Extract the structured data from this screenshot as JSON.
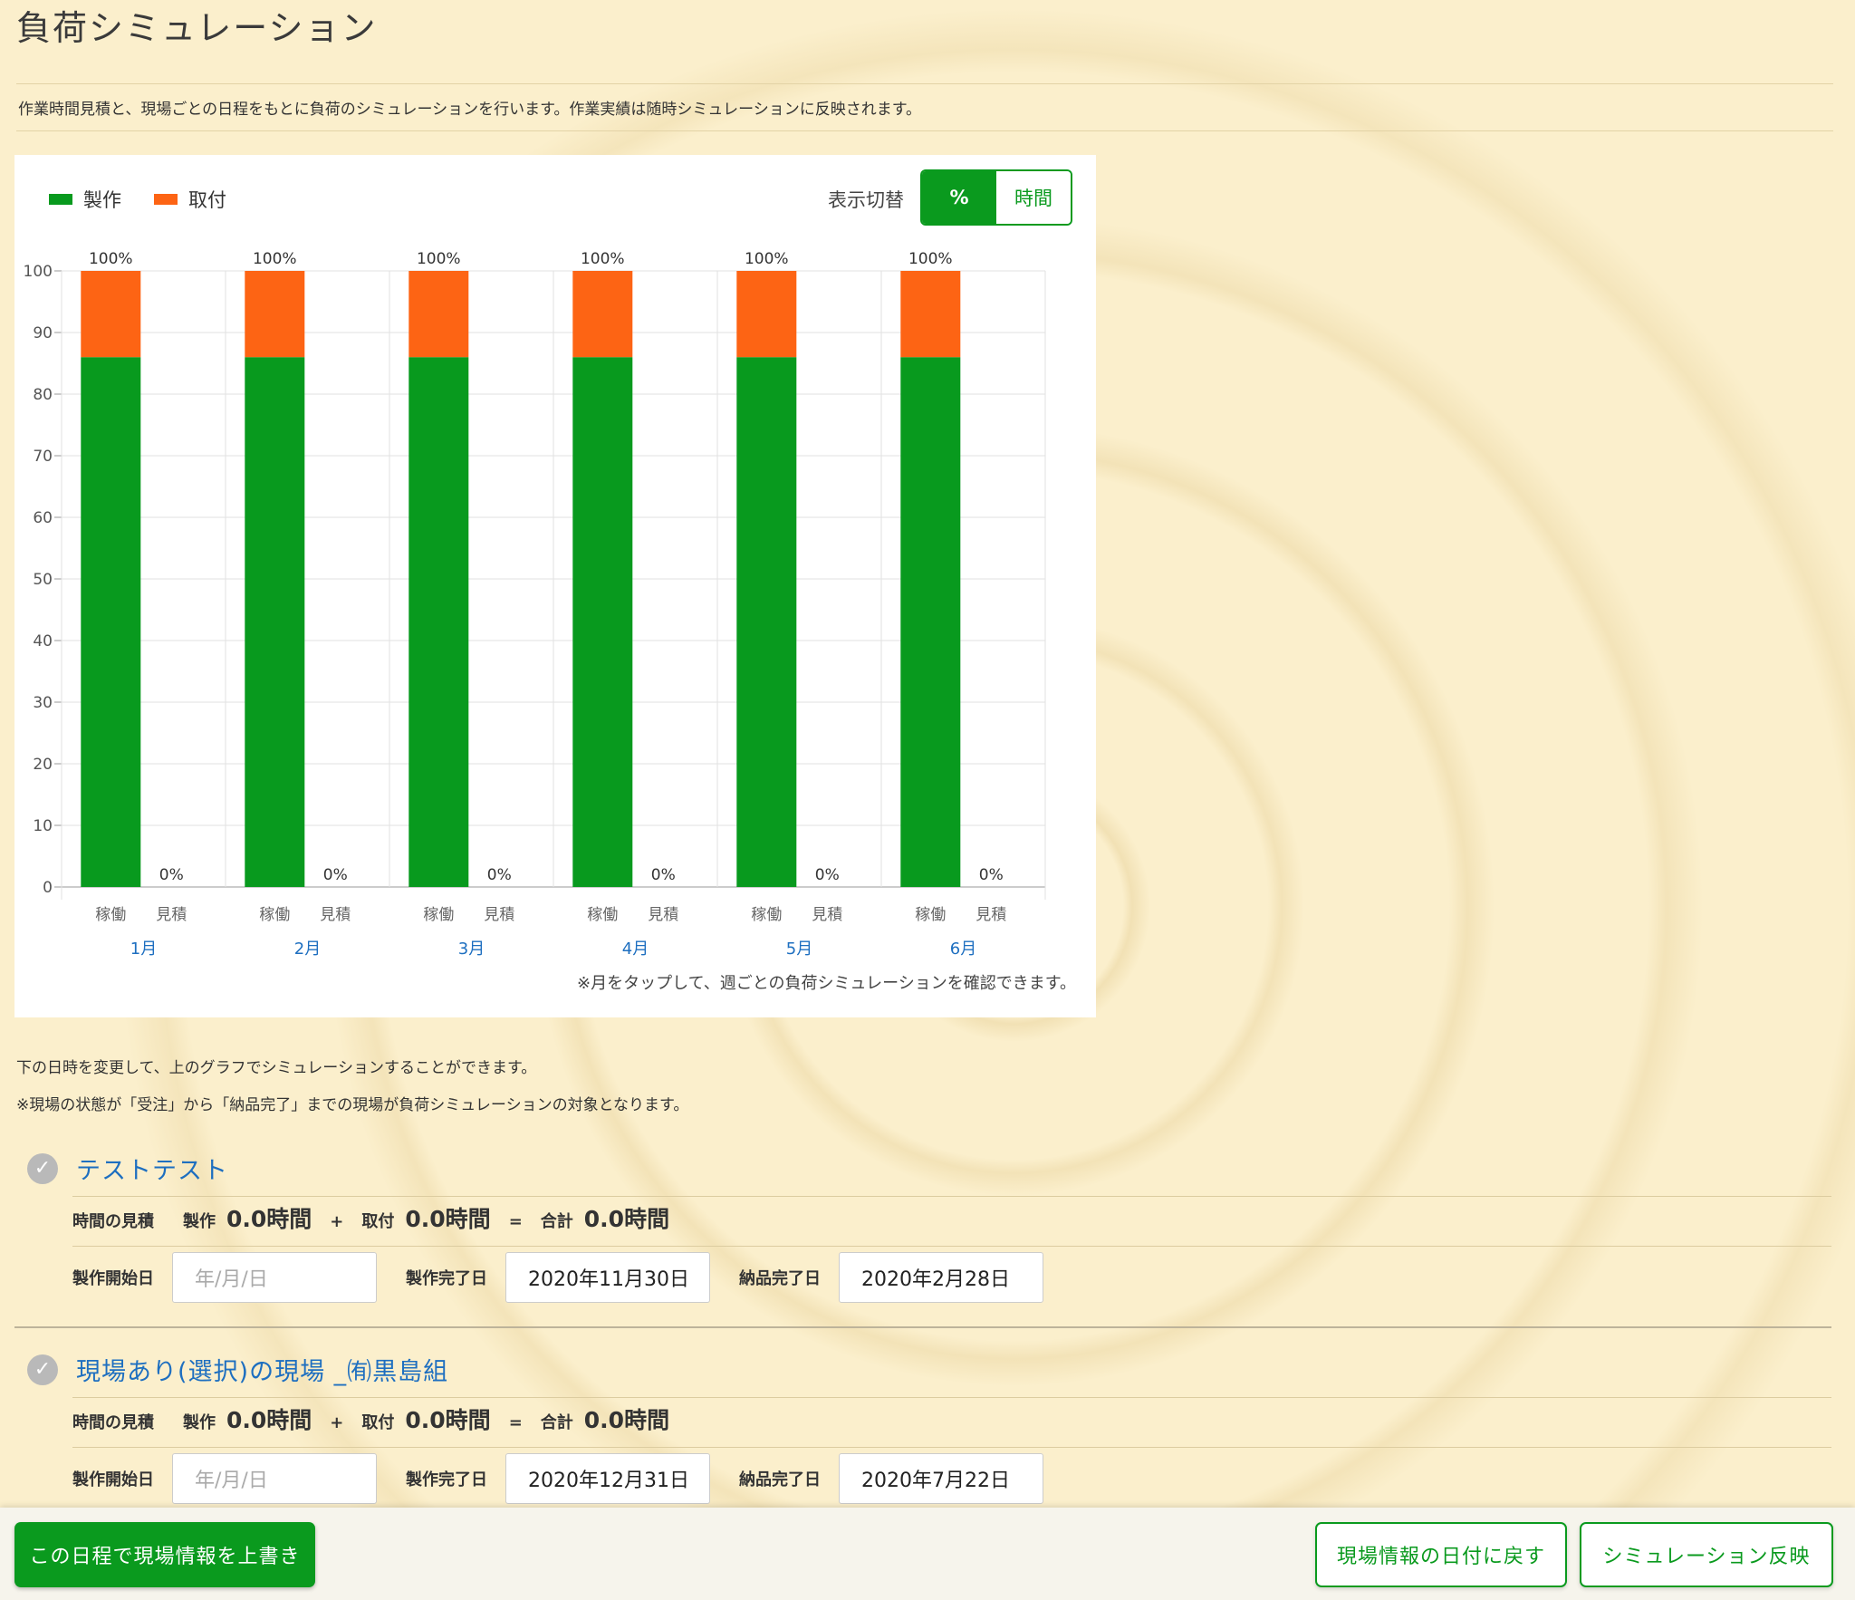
{
  "page": {
    "title": "負荷シミュレーション",
    "intro": "作業時間見積と、現場ごとの日程をもとに負荷のシミュレーションを行います。作業実績は随時シミュレーションに反映されます。"
  },
  "chart_card": {
    "toggle_label": "表示切替",
    "toggle_options": [
      "%",
      "時間"
    ],
    "toggle_selected": "%",
    "note": "※月をタップして、週ごとの負荷シミュレーションを確認できます。"
  },
  "chart_data": {
    "type": "bar",
    "stacked": true,
    "months": [
      "1月",
      "2月",
      "3月",
      "4月",
      "5月",
      "6月"
    ],
    "sub_categories": [
      "稼働",
      "見積"
    ],
    "series": [
      {
        "name": "製作",
        "color": "#089a1e",
        "values": {
          "稼働": [
            86,
            86,
            86,
            86,
            86,
            86
          ],
          "見積": [
            0,
            0,
            0,
            0,
            0,
            0
          ]
        }
      },
      {
        "name": "取付",
        "color": "#fd6414",
        "values": {
          "稼働": [
            14,
            14,
            14,
            14,
            14,
            14
          ],
          "見積": [
            0,
            0,
            0,
            0,
            0,
            0
          ]
        }
      }
    ],
    "total_labels": {
      "稼働": [
        "100%",
        "100%",
        "100%",
        "100%",
        "100%",
        "100%"
      ],
      "見積": [
        "0%",
        "0%",
        "0%",
        "0%",
        "0%",
        "0%"
      ]
    },
    "ylim": [
      0,
      100
    ],
    "yticks": [
      0,
      10,
      20,
      30,
      40,
      50,
      60,
      70,
      80,
      90,
      100
    ],
    "grid": true,
    "legend_position": "top-left"
  },
  "notes": {
    "line1": "下の日時を変更して、上のグラフでシミュレーションすることができます。",
    "line2": "※現場の状態が「受注」から「納品完了」までの現場が負荷シミュレーションの対象となります。"
  },
  "labels": {
    "estimate": "時間の見積",
    "make": "製作",
    "install": "取付",
    "plus": "+",
    "equals": "=",
    "total": "合計",
    "start_date": "製作開始日",
    "make_done": "製作完了日",
    "delivery_done": "納品完了日",
    "date_placeholder": "年/月/日"
  },
  "sites": [
    {
      "name": "テストテスト",
      "make_hours": "0.0時間",
      "install_hours": "0.0時間",
      "total_hours": "0.0時間",
      "start_date": "",
      "make_done_date": "2020年11月30日",
      "delivery_done_date": "2020年2月28日"
    },
    {
      "name": "現場あり(選択)の現場 _㈲黒島組",
      "make_hours": "0.0時間",
      "install_hours": "0.0時間",
      "total_hours": "0.0時間",
      "start_date": "",
      "make_done_date": "2020年12月31日",
      "delivery_done_date": "2020年7月22日"
    }
  ],
  "footer": {
    "overwrite_button": "この日程で現場情報を上書き",
    "revert_button": "現場情報の日付に戻す",
    "apply_button": "シミュレーション反映"
  }
}
